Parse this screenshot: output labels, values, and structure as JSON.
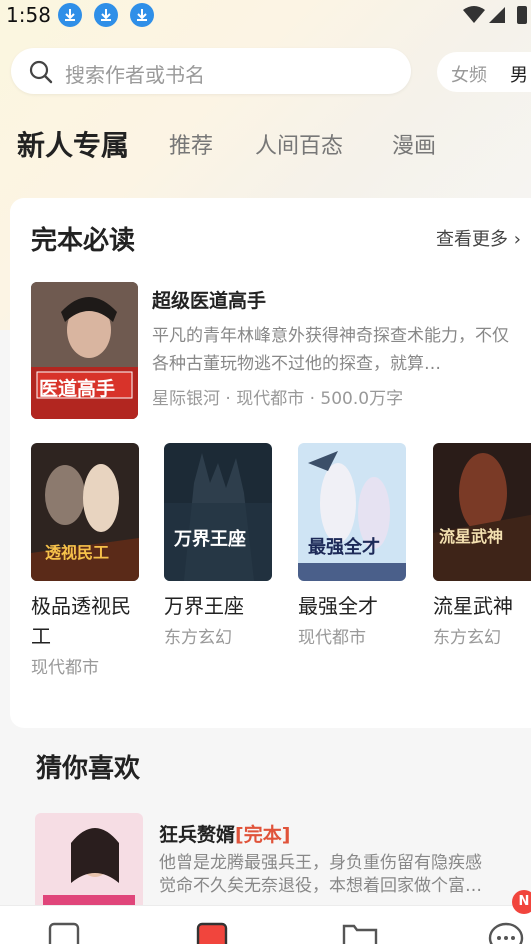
{
  "status_bar": {
    "time": "1:58"
  },
  "search": {
    "placeholder": "搜索作者或书名"
  },
  "gender_switch": {
    "female": "女频",
    "male": "男"
  },
  "tabs": [
    {
      "label": "新人专属",
      "active": true
    },
    {
      "label": "推荐",
      "active": false
    },
    {
      "label": "人间百态",
      "active": false
    },
    {
      "label": "漫画",
      "active": false
    }
  ],
  "complete_section": {
    "title": "完本必读",
    "more_label": "查看更多 ›",
    "featured": {
      "title": "超级医道高手",
      "cover_text": "医道高手",
      "description": "平凡的青年林峰意外获得神奇探查术能力，不仅各种古董玩物逃不过他的探查，就算…",
      "meta": "星际银河 · 现代都市 · 500.0万字"
    },
    "books": [
      {
        "title": "极品透视民工",
        "genre": "现代都市",
        "cover_text": "透视民工"
      },
      {
        "title": "万界王座",
        "genre": "东方玄幻",
        "cover_text": "万界王座"
      },
      {
        "title": "最强全才",
        "genre": "现代都市",
        "cover_text": "最强全才"
      },
      {
        "title": "流星武神",
        "genre": "东方玄幻",
        "cover_text": "流星武神"
      }
    ]
  },
  "guess_section": {
    "title": "猜你喜欢",
    "item": {
      "title": "狂兵赘婿",
      "tag": "[完本]",
      "desc_line1": "他曾是龙腾最强兵王，身负重伤留有隐疾感",
      "desc_line2": "觉命不久矣无奈退役，本想着回家做个富…"
    }
  },
  "bottom_nav": {
    "badge": "N"
  },
  "colors": {
    "accent": "#e0533a",
    "download_icon": "#2f8fe8",
    "badge": "#f1453d"
  }
}
